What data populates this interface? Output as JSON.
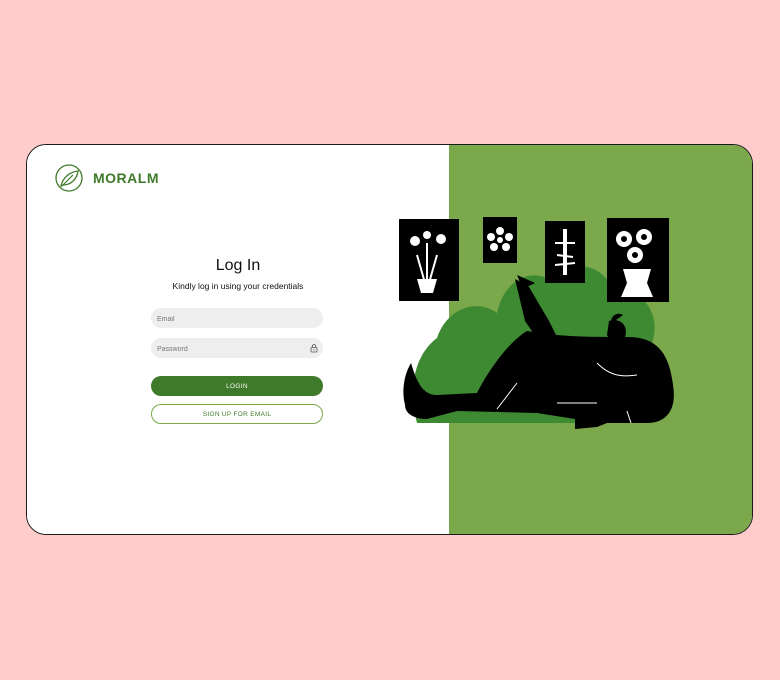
{
  "brand": {
    "name": "MORALM",
    "logo_icon": "leaf-circle-icon"
  },
  "login_form": {
    "title": "Log In",
    "subtitle": "Kindly log in using your credentials",
    "email_placeholder": "Email",
    "password_placeholder": "Password",
    "password_icon": "lock-icon",
    "login_label": "LOGIN",
    "signup_label": "SIGN UP FOR EMAIL"
  },
  "colors": {
    "page_background": "#ffcccb",
    "brand_green": "#3f7a2a",
    "panel_green": "#7aa84a",
    "bush_green": "#3d8a32",
    "figure": "#000000"
  },
  "illustration": {
    "description_icon": "person-reclining-with-plant-posters-illustration"
  }
}
